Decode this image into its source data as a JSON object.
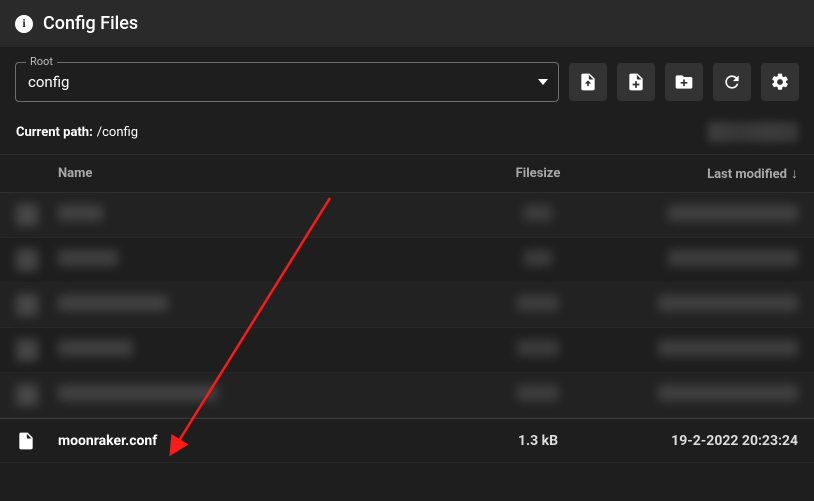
{
  "panel": {
    "title": "Config Files"
  },
  "rootSelect": {
    "label": "Root",
    "value": "config"
  },
  "currentPath": {
    "label": "Current path:",
    "value": "/config"
  },
  "columns": {
    "name": "Name",
    "size": "Filesize",
    "modified": "Last modified"
  },
  "visibleRow": {
    "name": "moonraker.conf",
    "size": "1.3 kB",
    "modified": "19-2-2022 20:23:24"
  }
}
